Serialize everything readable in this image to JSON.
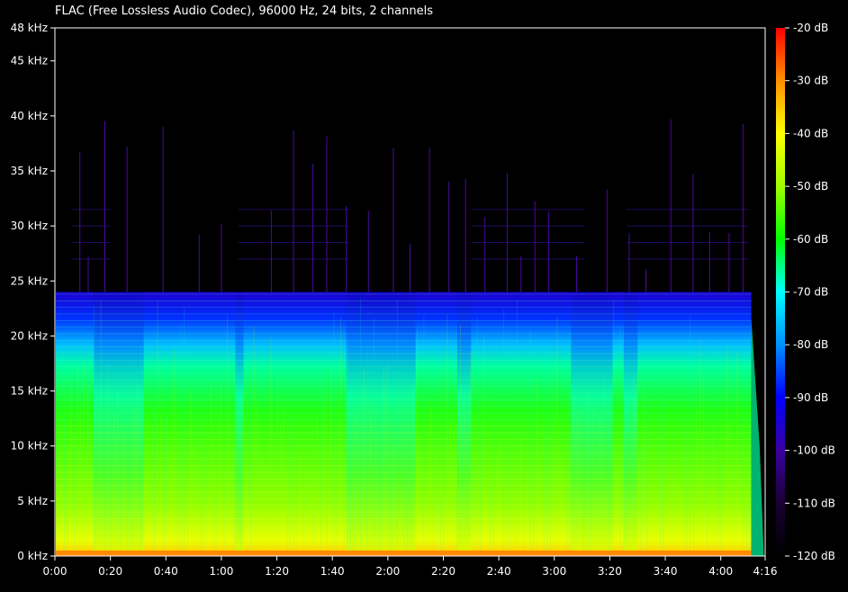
{
  "title": "FLAC (Free Lossless Audio Codec), 96000 Hz, 24 bits, 2 channels",
  "chart_data": {
    "type": "heatmap",
    "title": "FLAC (Free Lossless Audio Codec), 96000 Hz, 24 bits, 2 channels",
    "duration_seconds": 256,
    "ylim_khz": [
      0,
      48
    ],
    "db_range": [
      -120,
      -20
    ],
    "y_ticks": [
      {
        "khz": 48,
        "label": "48 kHz"
      },
      {
        "khz": 45,
        "label": "45 kHz"
      },
      {
        "khz": 40,
        "label": "40 kHz"
      },
      {
        "khz": 35,
        "label": "35 kHz"
      },
      {
        "khz": 30,
        "label": "30 kHz"
      },
      {
        "khz": 25,
        "label": "25 kHz"
      },
      {
        "khz": 20,
        "label": "20 kHz"
      },
      {
        "khz": 15,
        "label": "15 kHz"
      },
      {
        "khz": 10,
        "label": "10 kHz"
      },
      {
        "khz": 5,
        "label": "5 kHz"
      },
      {
        "khz": 0,
        "label": "0 kHz"
      }
    ],
    "x_ticks": [
      {
        "t": 0,
        "label": "0:00"
      },
      {
        "t": 20,
        "label": "0:20"
      },
      {
        "t": 40,
        "label": "0:40"
      },
      {
        "t": 60,
        "label": "1:00"
      },
      {
        "t": 80,
        "label": "1:20"
      },
      {
        "t": 100,
        "label": "1:40"
      },
      {
        "t": 120,
        "label": "2:00"
      },
      {
        "t": 140,
        "label": "2:20"
      },
      {
        "t": 160,
        "label": "2:40"
      },
      {
        "t": 180,
        "label": "3:00"
      },
      {
        "t": 200,
        "label": "3:20"
      },
      {
        "t": 220,
        "label": "3:40"
      },
      {
        "t": 240,
        "label": "4:00"
      },
      {
        "t": 256,
        "label": "4:16"
      }
    ],
    "colorbar_ticks": [
      {
        "db": -20,
        "label": "-20 dB"
      },
      {
        "db": -30,
        "label": "-30 dB"
      },
      {
        "db": -40,
        "label": "-40 dB"
      },
      {
        "db": -50,
        "label": "-50 dB"
      },
      {
        "db": -60,
        "label": "-60 dB"
      },
      {
        "db": -70,
        "label": "-70 dB"
      },
      {
        "db": -80,
        "label": "-80 dB"
      },
      {
        "db": -90,
        "label": "-90 dB"
      },
      {
        "db": -100,
        "label": "-100 dB"
      },
      {
        "db": -110,
        "label": "-110 dB"
      },
      {
        "db": -120,
        "label": "-120 dB"
      }
    ],
    "colormap": [
      "#000000",
      "#1a0033",
      "#3a00a0",
      "#0000ff",
      "#0090ff",
      "#00ffff",
      "#00ff00",
      "#a0ff00",
      "#ffff00",
      "#ff9000",
      "#ff0000"
    ],
    "content_cutoff_khz": 24,
    "music_end_seconds": 251
  }
}
